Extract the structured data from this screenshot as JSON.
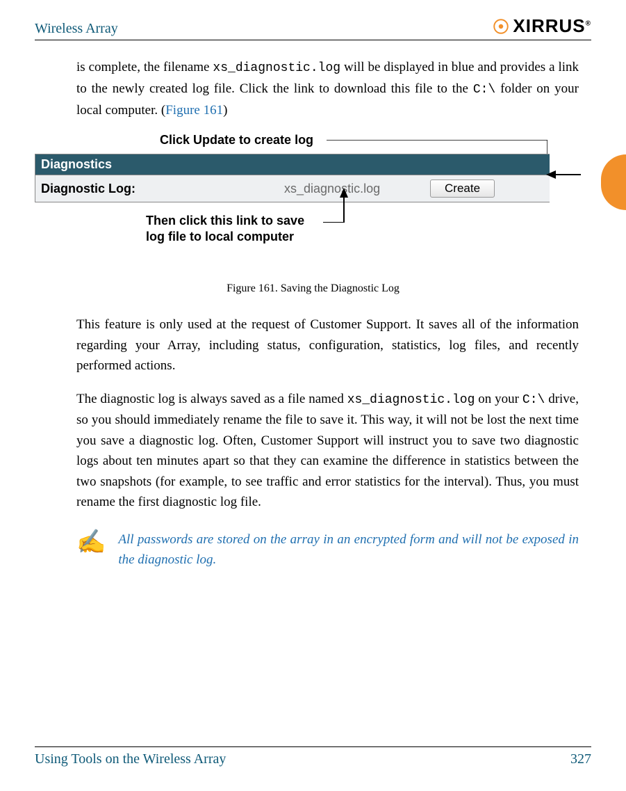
{
  "header": {
    "title": "Wireless Array",
    "brand": "XIRRUS"
  },
  "intro": {
    "pre": "is complete, the filename ",
    "file": "xs_diagnostic.log",
    "mid": " will be displayed in blue and provides a link to the newly created log file. Click the link to download this file to the ",
    "folder": "C:\\",
    "post": " folder on your local computer. (",
    "figref": "Figure 161",
    "close": ")"
  },
  "figure": {
    "annot_top": "Click Update to create log",
    "panel_title": "Diagnostics",
    "label": "Diagnostic Log:",
    "filename": "xs_diagnostic.log",
    "button": "Create",
    "annot_bottom_l1": "Then click this link to save",
    "annot_bottom_l2": "log file to local computer",
    "caption": "Figure 161. Saving the Diagnostic Log"
  },
  "para1": "This feature is only used at the request of Customer Support. It saves all of the information regarding your Array, including status, configuration, statistics, log files, and recently performed actions.",
  "para2": {
    "a": "The diagnostic log is always saved as a file named ",
    "file": "xs_diagnostic.log",
    "b": " on your ",
    "drive": "C:\\",
    "c": " drive, so you should immediately rename the file to save it. This way, it will not be lost the next time you save a diagnostic log. Often, Customer Support will instruct you to save two diagnostic logs about ten minutes apart so that they can examine the difference in statistics between the two snapshots (for example, to see traffic and error statistics for the interval). Thus, you must rename the first diagnostic log file."
  },
  "note": "All passwords are stored on the array in an encrypted form and will not be exposed in the diagnostic log.",
  "footer": {
    "section": "Using Tools on the Wireless Array",
    "page": "327"
  }
}
